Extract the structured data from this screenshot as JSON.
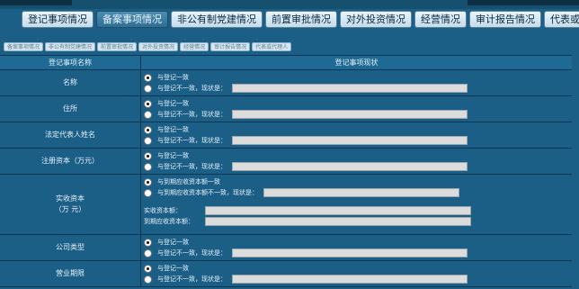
{
  "tabs": [
    {
      "label": "登记事项情况",
      "active": false
    },
    {
      "label": "备案事项情况",
      "active": true
    },
    {
      "label": "非公有制党建情况",
      "active": false
    },
    {
      "label": "前置审批情况",
      "active": false
    },
    {
      "label": "对外投资情况",
      "active": false
    },
    {
      "label": "经营情况",
      "active": false
    },
    {
      "label": "审计报告情况",
      "active": false
    },
    {
      "label": "代表或代理人",
      "active": false
    }
  ],
  "subtabs": [
    "备案事项情况",
    "非公有制党建情况",
    "前置审批情况",
    "对外投资情况",
    "经营情况",
    "审计报告情况",
    "代表或代理人"
  ],
  "table": {
    "col1_header": "登记事项名称",
    "col2_header": "登记事项现状",
    "rows": [
      {
        "label": "名称",
        "opt1": "与登记一致",
        "opt2": "与登记不一致，现状是："
      },
      {
        "label": "住所",
        "opt1": "与登记一致",
        "opt2": "与登记不一致，现状是："
      },
      {
        "label": "法定代表人姓名",
        "opt1": "与登记一致",
        "opt2": "与登记不一致，现状是："
      },
      {
        "label": "注册资本（万元）",
        "opt1": "与登记一致",
        "opt2": "与登记不一致，现状是："
      }
    ],
    "capital_row": {
      "label_line1": "实收资本",
      "label_line2": "（万 元）",
      "opt1": "与到期应收资本额一致",
      "opt2": "与到期应收资本额不一致，现状是：",
      "paid_label": "实收资本额：",
      "due_label": "到期应收资本额："
    },
    "rows_after": [
      {
        "label": "公司类型",
        "opt1": "与登记一致",
        "opt2": "与登记不一致，现状是："
      },
      {
        "label": "营业期限",
        "opt1": "与登记一致",
        "opt2": "与登记不一致，现状是："
      }
    ]
  }
}
